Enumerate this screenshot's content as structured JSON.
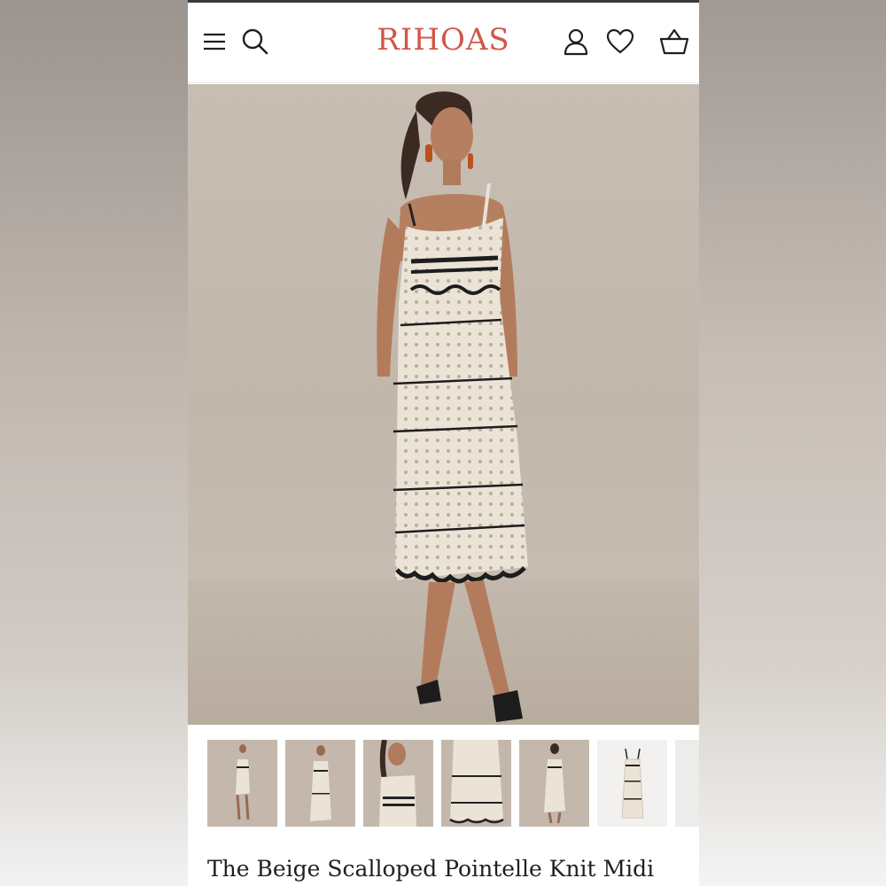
{
  "header": {
    "logo": "RIHOAS",
    "menu_icon": "hamburger-icon",
    "search_icon": "search-icon",
    "account_icon": "user-icon",
    "wishlist_icon": "heart-icon",
    "cart_icon": "basket-icon"
  },
  "product": {
    "title": "The Beige Scalloped Pointelle Knit Midi"
  },
  "gallery": {
    "thumbnail_count_visible": 7
  },
  "colors": {
    "brand": "#d0574b",
    "text": "#1f1f1f"
  }
}
